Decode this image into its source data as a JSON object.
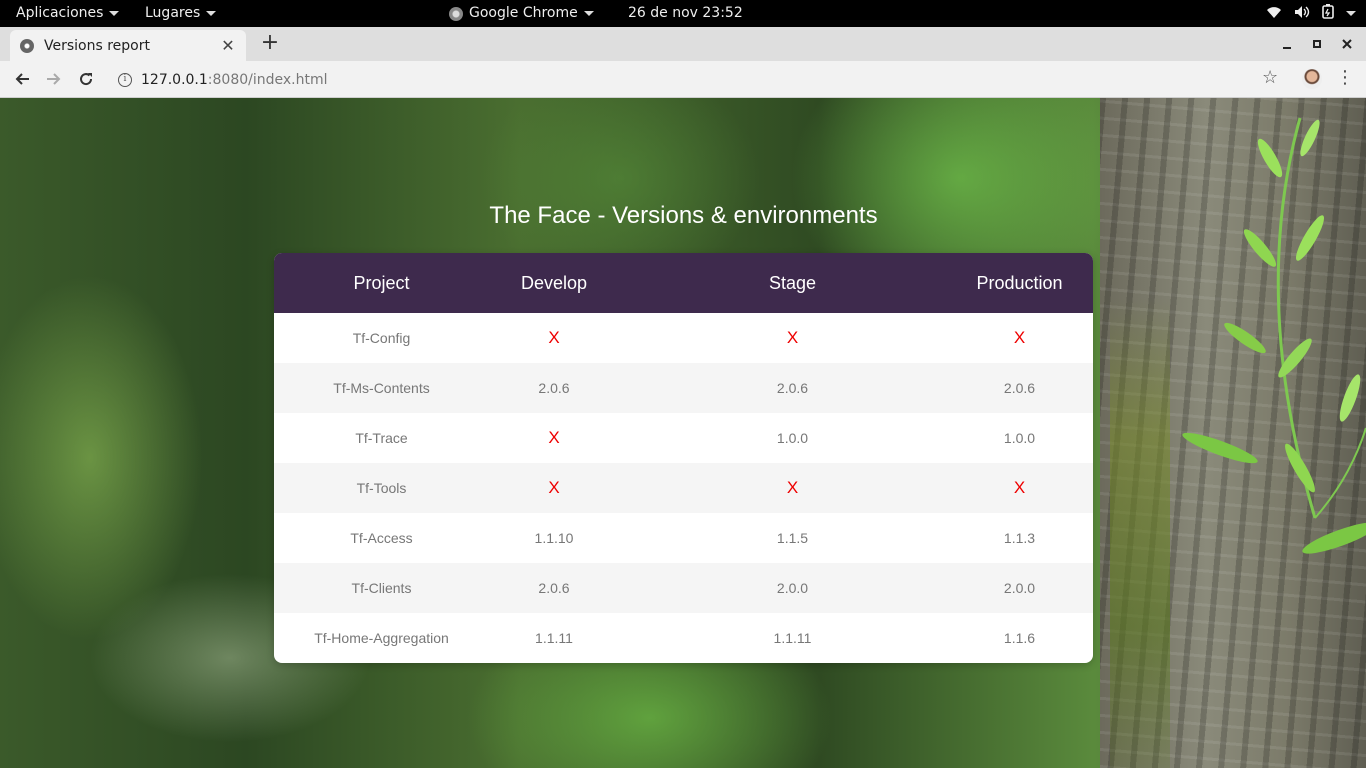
{
  "system_bar": {
    "apps_menu": "Aplicaciones",
    "places_menu": "Lugares",
    "active_app": "Google Chrome",
    "clock": "26 de nov  23:52"
  },
  "browser": {
    "tab_title": "Versions report",
    "new_tab_symbol": "+",
    "url_host": "127.0.0.1",
    "url_rest": ":8080/index.html"
  },
  "report": {
    "title": "The Face - Versions & environments",
    "headers": {
      "project": "Project",
      "develop": "Develop",
      "stage": "Stage",
      "production": "Production"
    },
    "missing_marker": "X",
    "rows": [
      {
        "project": "Tf-Config",
        "develop": "X",
        "stage": "X",
        "production": "X"
      },
      {
        "project": "Tf-Ms-Contents",
        "develop": "2.0.6",
        "stage": "2.0.6",
        "production": "2.0.6"
      },
      {
        "project": "Tf-Trace",
        "develop": "X",
        "stage": "1.0.0",
        "production": "1.0.0"
      },
      {
        "project": "Tf-Tools",
        "develop": "X",
        "stage": "X",
        "production": "X"
      },
      {
        "project": "Tf-Access",
        "develop": "1.1.10",
        "stage": "1.1.5",
        "production": "1.1.3"
      },
      {
        "project": "Tf-Clients",
        "develop": "2.0.6",
        "stage": "2.0.0",
        "production": "2.0.0"
      },
      {
        "project": "Tf-Home-Aggregation",
        "develop": "1.1.11",
        "stage": "1.1.11",
        "production": "1.1.6"
      }
    ]
  },
  "colors": {
    "header_bg": "#3e2a4d",
    "missing": "#ee0000",
    "row_alt": "#f5f5f5"
  }
}
